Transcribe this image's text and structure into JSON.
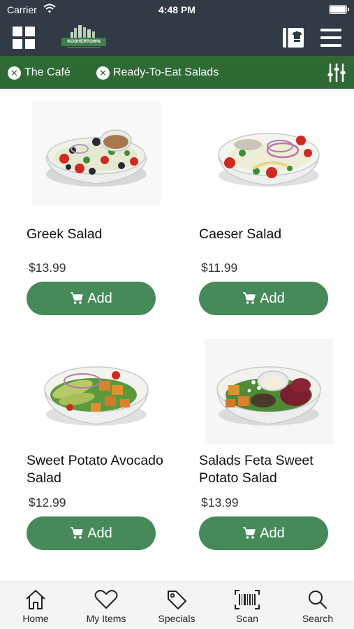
{
  "status": {
    "carrier": "Carrier",
    "time": "4:48 PM"
  },
  "nav": {
    "logo_text": "KOSHERTOWN"
  },
  "filters": [
    {
      "label": "The Café"
    },
    {
      "label": "Ready-To-Eat Salads"
    }
  ],
  "products": [
    {
      "name": "Greek Salad",
      "price": "$13.99",
      "button": "Add"
    },
    {
      "name": "Caeser Salad",
      "price": "$11.99",
      "button": "Add"
    },
    {
      "name": "Sweet Potato Avocado Salad",
      "price": "$12.99",
      "button": "Add"
    },
    {
      "name": "Salads Feta Sweet Potato Salad",
      "price": "$13.99",
      "button": "Add"
    }
  ],
  "tabs": [
    {
      "label": "Home",
      "icon": "home-icon"
    },
    {
      "label": "My Items",
      "icon": "heart-icon"
    },
    {
      "label": "Specials",
      "icon": "tag-icon"
    },
    {
      "label": "Scan",
      "icon": "barcode-icon"
    },
    {
      "label": "Search",
      "icon": "search-icon"
    }
  ],
  "colors": {
    "header": "#313b46",
    "filter_bar": "#2f6a35",
    "button": "#468a5a"
  }
}
